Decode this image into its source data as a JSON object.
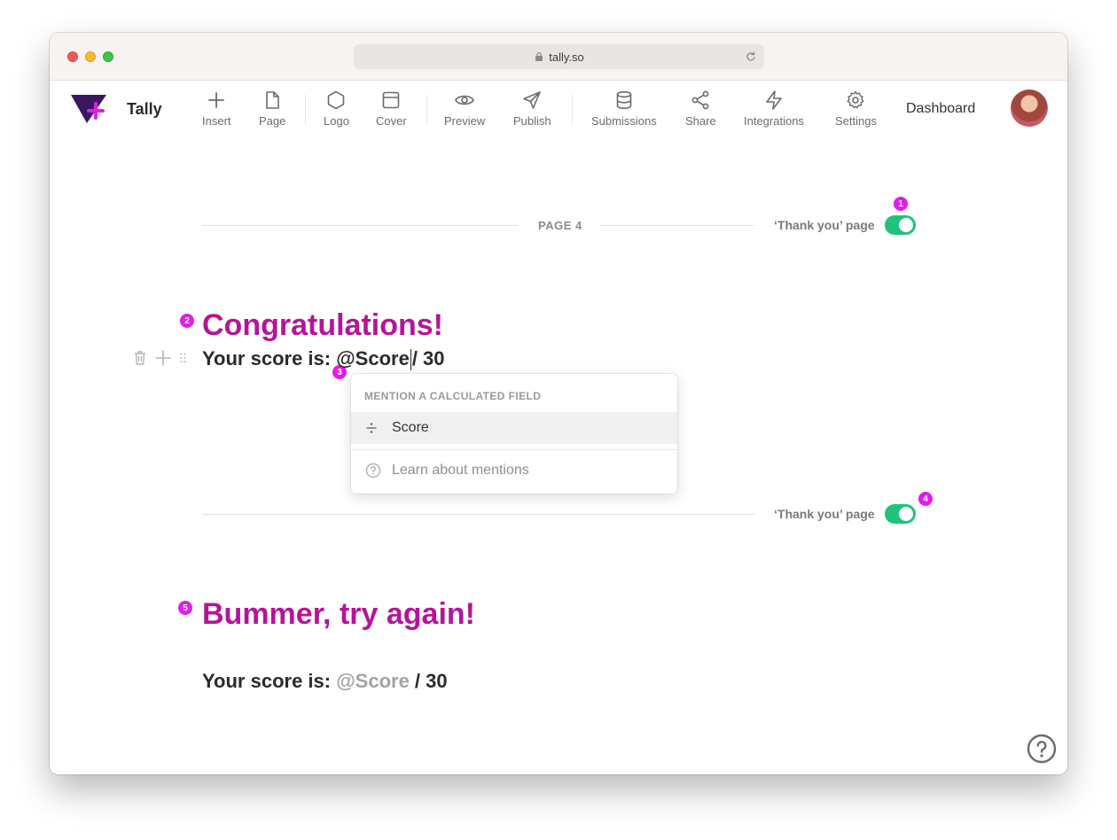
{
  "browser": {
    "url": "tally.so"
  },
  "app": {
    "brand": "Tally"
  },
  "toolbar": [
    {
      "label": "Insert",
      "icon": "plus-icon"
    },
    {
      "label": "Page",
      "icon": "page-icon"
    },
    {
      "label": "Logo",
      "icon": "hexagon-icon"
    },
    {
      "label": "Cover",
      "icon": "cover-icon"
    },
    {
      "label": "Preview",
      "icon": "eye-icon"
    },
    {
      "label": "Publish",
      "icon": "send-icon"
    },
    {
      "label": "Submissions",
      "icon": "database-icon"
    },
    {
      "label": "Share",
      "icon": "share-icon"
    },
    {
      "label": "Integrations",
      "icon": "lightning-icon"
    },
    {
      "label": "Settings",
      "icon": "gear-icon"
    }
  ],
  "nav": {
    "dashboard": "Dashboard"
  },
  "page_divider": {
    "label": "PAGE 4",
    "thank_you": "‘Thank you’ page",
    "thank_you_on": true
  },
  "badges": [
    "1",
    "2",
    "3",
    "4",
    "5"
  ],
  "block1": {
    "heading": "Congratulations!",
    "score_prefix": "Your score is: ",
    "mention": "@Score",
    "score_suffix": "/ 30"
  },
  "dropdown": {
    "header": "MENTION A CALCULATED FIELD",
    "item": "Score",
    "learn": "Learn about mentions"
  },
  "divider2": {
    "thank_you": "‘Thank you’ page",
    "thank_you_on": true
  },
  "block2": {
    "heading": "Bummer, try again!",
    "score_prefix": "Your score is: ",
    "mention": "@Score",
    "score_suffix": " / 30"
  },
  "colors": {
    "accent": "#b5149a",
    "toggle": "#22c27c",
    "badge": "#e01ee8"
  }
}
